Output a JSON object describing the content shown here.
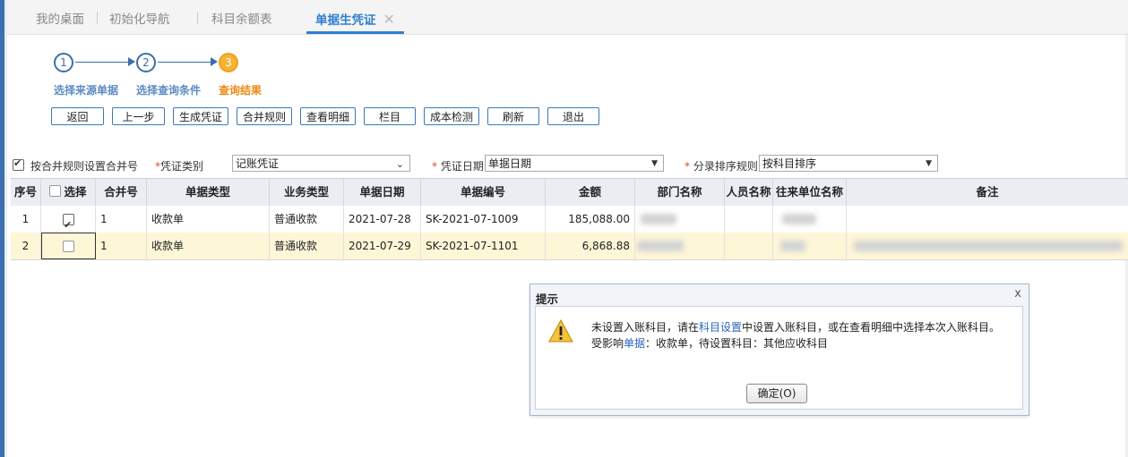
{
  "tabs": [
    {
      "label": "我的桌面",
      "active": false
    },
    {
      "label": "初始化导航",
      "active": false
    },
    {
      "label": "科目余额表",
      "active": false
    },
    {
      "label": "单据生凭证",
      "active": true
    }
  ],
  "tab_close": "✕",
  "steps": [
    {
      "number": "1",
      "label": "选择来源单据",
      "current": false
    },
    {
      "number": "2",
      "label": "选择查询条件",
      "current": false
    },
    {
      "number": "3",
      "label": "查询结果",
      "current": true
    }
  ],
  "toolbar": [
    "返回",
    "上一步",
    "生成凭证",
    "合并规则",
    "查看明细",
    "栏目",
    "成本检测",
    "刷新",
    "退出"
  ],
  "filters": {
    "merge_checkbox_label": "按合并规则设置合并号",
    "merge_checked": true,
    "voucher_type_label": "凭证类别",
    "voucher_type_value": "记账凭证",
    "voucher_date_label": "凭证日期",
    "voucher_date_value": "单据日期",
    "sort_label": "分录排序规则",
    "sort_value": "按科目排序",
    "required_mark": "*"
  },
  "table": {
    "headers": [
      "序号",
      "选择",
      "合并号",
      "单据类型",
      "业务类型",
      "单据日期",
      "单据编号",
      "金额",
      "部门名称",
      "人员名称",
      "往来单位名称",
      "备注"
    ],
    "rows": [
      {
        "index": "1",
        "checked": true,
        "merge_no": "1",
        "doc_type": "收款单",
        "biz_type": "普通收款",
        "date": "2021-07-28",
        "doc_no": "SK-2021-07-1009",
        "amount": "185,088.00"
      },
      {
        "index": "2",
        "checked": false,
        "merge_no": "1",
        "doc_type": "收款单",
        "biz_type": "普通收款",
        "date": "2021-07-29",
        "doc_no": "SK-2021-07-1101",
        "amount": "6,868.88"
      }
    ]
  },
  "dialog": {
    "title": "提示",
    "close": "x",
    "line1_a": "未设置入账科目，请在",
    "line1_link": "科目设置",
    "line1_b": "中设置入账科目，或在查看明细中选择本次入账科目。",
    "line2_a": "受影响",
    "line2_link": "单据",
    "line2_b": "：收款单，待设置科目：其他应收科目",
    "ok": "确定(O)"
  },
  "colors": {
    "accent": "#2f7fd0",
    "step_current": "#f4b534",
    "row_highlight": "#fdf6d7"
  }
}
